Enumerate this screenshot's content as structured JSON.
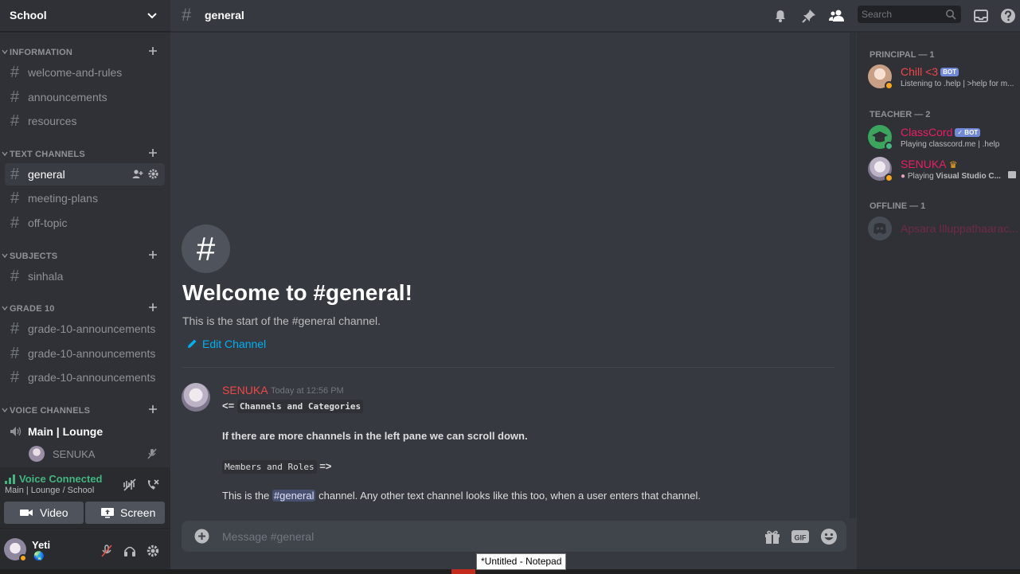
{
  "server": {
    "name": "School"
  },
  "categories": {
    "information": "INFORMATION",
    "text_channels": "TEXT CHANNELS",
    "subjects": "SUBJECTS",
    "grade10": "GRADE 10",
    "voice_channels": "VOICE CHANNELS"
  },
  "channels": {
    "information": [
      "welcome-and-rules",
      "announcements",
      "resources"
    ],
    "text": [
      "general",
      "meeting-plans",
      "off-topic"
    ],
    "subjects": [
      "sinhala"
    ],
    "grade10": [
      "grade-10-announcements",
      "grade-10-announcements",
      "grade-10-announcements"
    ]
  },
  "voice": {
    "channel": "Main | Lounge",
    "user": "SENUKA",
    "status": "Voice Connected",
    "location": "Main | Lounge / School",
    "video_label": "Video",
    "screen_label": "Screen"
  },
  "user": {
    "name": "Yeti",
    "status_icon": "earth-icon"
  },
  "topbar": {
    "channel": "general",
    "search_placeholder": "Search"
  },
  "welcome": {
    "icon": "#",
    "title": "Welcome to #general!",
    "subtitle": "This is the start of the #general channel.",
    "edit": "Edit Channel"
  },
  "message": {
    "author": "SENUKA",
    "time": "Today at 12:56 PM",
    "line1_prefix": "<=",
    "line1_code": "Channels and Categories",
    "line2": "If there are more channels in the left pane we can scroll down.",
    "line3_code": "Members and Roles",
    "line3_suffix": "=>",
    "line4_before": "This is the",
    "line4_mention": "#general",
    "line4_after": "channel. Any other text channel looks like this too, when a user enters that channel."
  },
  "composer": {
    "placeholder": "Message #general",
    "gif_label": "GIF"
  },
  "members": {
    "groups": {
      "principal": "PRINCIPAL — 1",
      "teacher": "TEACHER — 2",
      "offline": "OFFLINE — 1"
    },
    "list": [
      {
        "name": "Chill <3",
        "badge": "BOT",
        "activity": "Listening to .help | >help for m...",
        "color": "#f04747",
        "status": "#faa61a"
      },
      {
        "name": "ClassCord",
        "badge": "✓ BOT",
        "activity": "Playing classcord.me | .help",
        "color": "#e91e63",
        "status": "#43b581"
      },
      {
        "name": "SENUKA",
        "badge": "",
        "activity_prefix": "Playing",
        "activity_bold": "Visual Studio C...",
        "color": "#e91e63",
        "status": "#faa61a"
      },
      {
        "name": "Apsara Illuppathaarac...",
        "badge": "",
        "activity": "",
        "color": "#5b2a3a",
        "status": ""
      }
    ]
  },
  "tooltip": "*Untitled - Notepad"
}
